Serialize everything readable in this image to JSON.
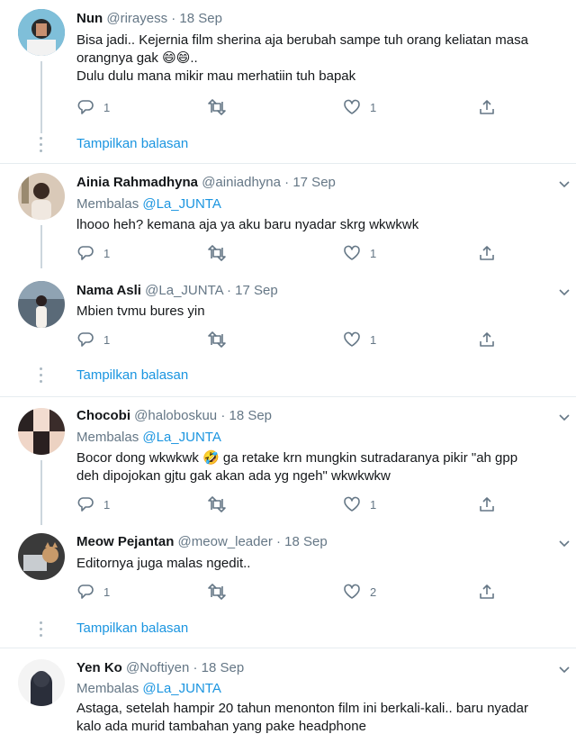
{
  "show_replies_label": "Tampilkan balasan",
  "reply_prefix": "Membalas",
  "tweets": [
    {
      "name": "Nun",
      "handle": "@rirayess",
      "date": "· 18 Sep",
      "lines": [
        "Bisa jadi.. Kejernia film sherina aja berubah sampe tuh orang keliatan masa",
        "orangnya gak 😄😄..",
        "Dulu dulu mana mikir mau merhatiin tuh bapak"
      ],
      "replies": "1",
      "retweets": "",
      "likes": "1"
    },
    {
      "name": "Ainia Rahmadhyna",
      "handle": "@ainiadhyna",
      "date": "· 17 Sep",
      "reply_to": "@La_JUNTA",
      "lines": [
        "lhooo heh? kemana aja ya aku baru nyadar skrg wkwkwk"
      ],
      "replies": "1",
      "retweets": "",
      "likes": "1"
    },
    {
      "name": "Nama Asli",
      "handle": "@La_JUNTA",
      "date": "· 17 Sep",
      "lines": [
        "Mbien tvmu bures yin"
      ],
      "replies": "1",
      "retweets": "",
      "likes": "1"
    },
    {
      "name": "Chocobi",
      "handle": "@haloboskuu",
      "date": "· 18 Sep",
      "reply_to": "@La_JUNTA",
      "lines": [
        "Bocor dong wkwkwk 🤣 ga retake krn mungkin sutradaranya pikir \"ah gpp",
        "deh dipojokan gjtu gak akan ada yg ngeh\" wkwkwkw"
      ],
      "replies": "1",
      "retweets": "",
      "likes": "1"
    },
    {
      "name": "Meow Pejantan",
      "handle": "@meow_leader",
      "date": "· 18 Sep",
      "lines": [
        "Editornya juga malas ngedit.."
      ],
      "replies": "1",
      "retweets": "",
      "likes": "2"
    },
    {
      "name": "Yen Ko",
      "handle": "@Noftiyen",
      "date": "· 18 Sep",
      "reply_to": "@La_JUNTA",
      "lines": [
        "Astaga, setelah hampir 20 tahun menonton film ini berkali-kali.. baru nyadar",
        "kalo ada murid tambahan yang pake headphone"
      ]
    }
  ],
  "colors": {
    "link": "#1b95e0",
    "muted": "#657786",
    "divider": "#e6ecf0",
    "thread_line": "#ccd6dd"
  }
}
